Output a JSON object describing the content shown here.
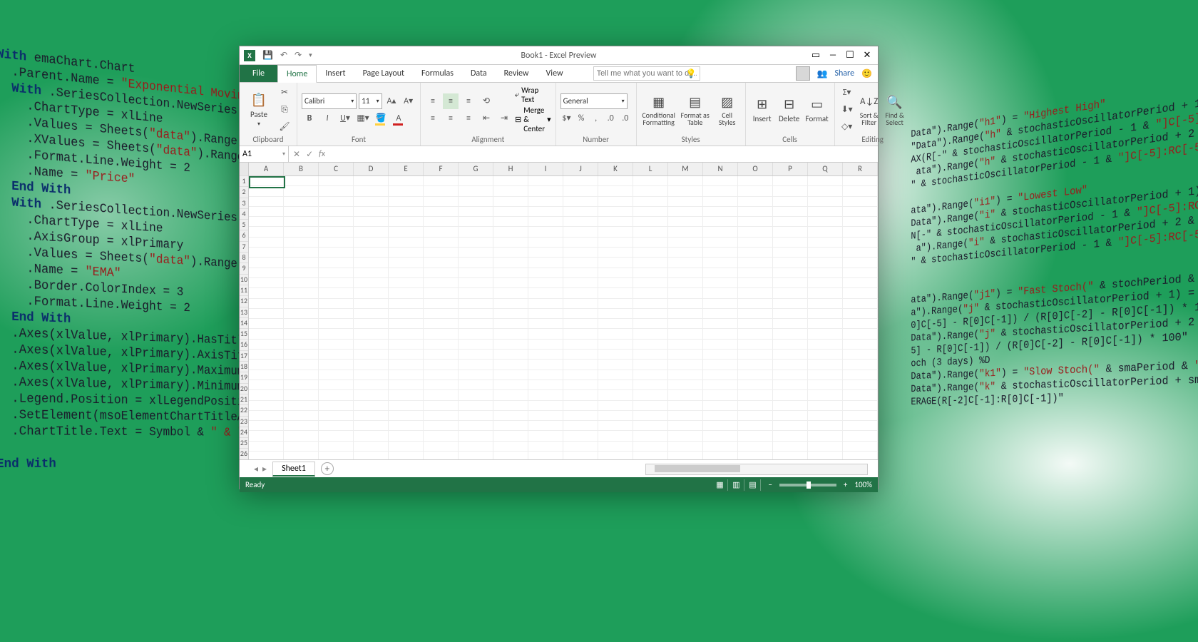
{
  "window": {
    "title": "Book1 - Excel Preview"
  },
  "ribbon": {
    "tabs": {
      "file": "File",
      "home": "Home",
      "insert": "Insert",
      "page_layout": "Page Layout",
      "formulas": "Formulas",
      "data": "Data",
      "review": "Review",
      "view": "View"
    },
    "tellme_placeholder": "Tell me what you want to do...",
    "share": "Share",
    "groups": {
      "clipboard": {
        "paste": "Paste",
        "label": "Clipboard"
      },
      "font": {
        "name": "Calibri",
        "size": "11",
        "label": "Font"
      },
      "alignment": {
        "wrap": "Wrap Text",
        "merge": "Merge & Center",
        "label": "Alignment"
      },
      "number": {
        "format": "General",
        "label": "Number"
      },
      "styles": {
        "cond": "Conditional Formatting",
        "table": "Format as Table",
        "cell": "Cell Styles",
        "label": "Styles"
      },
      "cells": {
        "insert": "Insert",
        "delete": "Delete",
        "format": "Format",
        "label": "Cells"
      },
      "editing": {
        "sort": "Sort & Filter",
        "find": "Find & Select",
        "label": "Editing"
      }
    }
  },
  "namebox": "A1",
  "columns": [
    "A",
    "B",
    "C",
    "D",
    "E",
    "F",
    "G",
    "H",
    "I",
    "J",
    "K",
    "L",
    "M",
    "N",
    "O",
    "P",
    "Q",
    "R"
  ],
  "rows": 28,
  "sheet": {
    "name": "Sheet1",
    "status": "Ready",
    "zoom": "100%"
  },
  "code_left": "<span class='kw'>With</span> emaChart.Chart\n  .Parent.Name = <span class='str'>\"Exponential Moving Avg. Chart\"</span>\n  <span class='kw'>With</span> .SeriesCollection.NewSeries\n    .ChartType = xlLine\n    .Values = Sheets(<span class='str'>\"data\"</span>).Range(<span class='str'>\"e2:e\"</span> & rowCount)\n    .XValues = Sheets(<span class='str'>\"data\"</span>).Range(<span class='str'>\"a2:a\"</span> & rowCount)\n    .Format.Line.Weight = 2\n    .Name = <span class='str'>\"Price\"</span>\n  <span class='kw'>End With</span>\n  <span class='kw'>With</span> .SeriesCollection.NewSeries\n    .ChartType = xlLine\n    .AxisGroup = xlPrimary\n    .Values = Sheets(<span class='str'>\"data\"</span>).Range(<span class='str'>\"h2:h\"</span> & rowCount)\n    .Name = <span class='str'>\"EMA\"</span>\n    .Border.ColorIndex = 3\n    .Format.Line.Weight = 2\n  <span class='kw'>End With</span>\n  .Axes(xlValue, xlPrimary).HasTitle = <span class='kw'>True</span>\n  .Axes(xlValue, xlPrimary).AxisTitle.Characters.Text\n  .Axes(xlValue, xlPrimary).MaximumScale = Worksheet\n  .Axes(xlValue, xlPrimary).MinimumScale = Int(Works\n  .Legend.Position = xlLegendPositionBottom\n  .SetElement(msoElementChartTitleAboveChart)\n  .ChartTitle.Text = Symbol & <span class='str'>\" & \"</span> <span class='str'>\"Close Price vs \"</span>\n\n<span class='kw'>End With</span>",
  "code_right": "Data\").Range(<span class='str'>\"h1\"</span>) = <span class='str'>\"Highest High\"</span>\n\"Data\").Range(<span class='str'>\"h\"</span> & stochasticOscillatorPeriod + 1) = _\nAX(R[-\" & stochasticOscillatorPeriod - 1 & <span class='str'>\"]C[-5]:RC[-5])\"</span>\n ata\").Range(<span class='str'>\"h\"</span> & stochasticOscillatorPeriod + 2 & <span class='str'>\":h\"</span> & r\n\" & stochasticOscillatorPeriod - 1 & <span class='str'>\"]C[-5]:RC[-5])\"</span>\n\nata\").Range(<span class='str'>\"i1\"</span>) = <span class='str'>\"Lowest Low\"</span>\nData\").Range(<span class='str'>\"i\"</span> & stochasticOscillatorPeriod + 1) = _\nN[-\" & stochasticOscillatorPeriod - 1 & <span class='str'>\"]C[-5]:RC[-5])\"</span>\n a\").Range(<span class='str'>\"i\"</span> & stochasticOscillatorPeriod + 2 & <span class='str'>\":i\"</span> & r\n\" & stochasticOscillatorPeriod - 1 & <span class='str'>\"]C[-5]:RC[-5])\"</span>\n\n\nata\").Range(<span class='str'>\"j1\"</span>) = <span class='str'>\"Fast Stoch(\"</span> & stochPeriod & <span class='str'>\"days) %K\"</span>\na\").Range(<span class='str'>\"j\"</span> & stochasticOscillatorPeriod + 1) = _\n0]C[-5] - R[0]C[-1]) / (R[0]C[-2] - R[0]C[-1]) * 100\"\nData\").Range(<span class='str'>\"j\"</span> & stochasticOscillatorPeriod + 2 & <span class='str'>\":j\"</span> & r\n5] - R[0]C[-1]) / (R[0]C[-2] - R[0]C[-1]) * 100\"\noch (3 days) %D\nData\").Range(<span class='str'>\"k1\"</span>) = <span class='str'>\"Slow Stoch(\"</span> & smaPeriod & <span class='str'>\"days) %D\"</span>\nData\").Range(<span class='str'>\"k\"</span> & stochasticOscillatorPeriod + smaPeriod)\nERAGE(R[-2]C[-1]:R[0]C[-1])\""
}
